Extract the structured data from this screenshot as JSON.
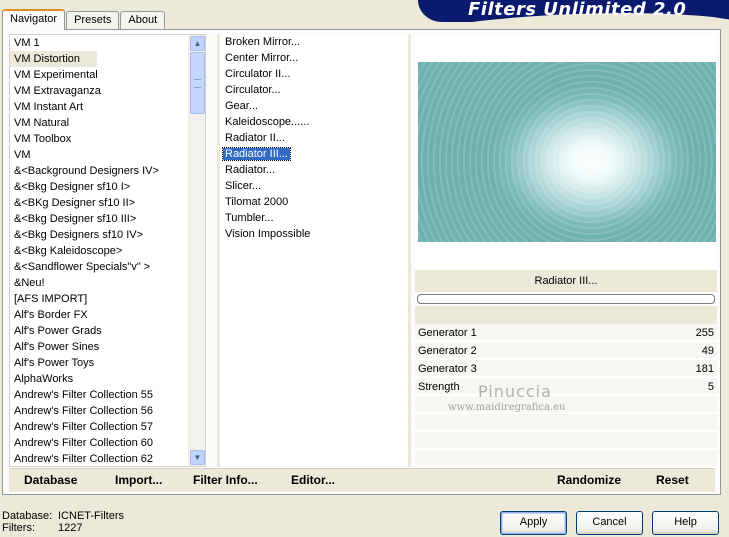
{
  "header": {
    "title": "Filters Unlimited 2.0"
  },
  "tabs": [
    {
      "label": "Navigator",
      "active": true
    },
    {
      "label": "Presets",
      "active": false
    },
    {
      "label": "About",
      "active": false
    }
  ],
  "categories": {
    "selected": "VM Distortion",
    "items": [
      "VM 1",
      "VM Distortion",
      "VM Experimental",
      "VM Extravaganza",
      "VM Instant Art",
      "VM Natural",
      "VM Toolbox",
      "VM",
      "&<Background Designers IV>",
      "&<Bkg Designer sf10 I>",
      "&<BKg Designer sf10 II>",
      "&<Bkg Designer sf10 III>",
      "&<Bkg Designers sf10 IV>",
      "&<Bkg Kaleidoscope>",
      "&<Sandflower Specials\"v\" >",
      "&Neu!",
      "[AFS IMPORT]",
      "Alf's Border FX",
      "Alf's Power Grads",
      "Alf's Power Sines",
      "Alf's Power Toys",
      "AlphaWorks",
      "Andrew's Filter Collection 55",
      "Andrew's Filter Collection 56",
      "Andrew's Filter Collection 57",
      "Andrew's Filter Collection 60",
      "Andrew's Filter Collection 62"
    ]
  },
  "filters": {
    "selected": "Radiator III...",
    "items": [
      "Broken Mirror...",
      "Center Mirror...",
      "Circulator II...",
      "Circulator...",
      "Gear...",
      "Kaleidoscope......",
      "Radiator II...",
      "Radiator III...",
      "Radiator...",
      "Slicer...",
      "Tilomat 2000",
      "Tumbler...",
      "Vision Impossible"
    ]
  },
  "preview": {
    "filter_name": "Radiator III...",
    "progress": 0
  },
  "params": [
    {
      "label": "Generator 1",
      "value": "255"
    },
    {
      "label": "Generator 2",
      "value": "49"
    },
    {
      "label": "Generator 3",
      "value": "181"
    },
    {
      "label": "Strength",
      "value": "5"
    }
  ],
  "watermark": {
    "name": "Pinuccia",
    "url": "www.maidiregrafica.eu"
  },
  "bottom_links": {
    "database": "Database",
    "import": "Import...",
    "filter_info": "Filter Info...",
    "editor": "Editor...",
    "randomize": "Randomize",
    "reset": "Reset"
  },
  "status": {
    "database_label": "Database:",
    "database_value": "ICNET-Filters",
    "filters_label": "Filters:",
    "filters_value": "1227"
  },
  "buttons": {
    "apply": "Apply",
    "cancel": "Cancel",
    "help": "Help"
  }
}
